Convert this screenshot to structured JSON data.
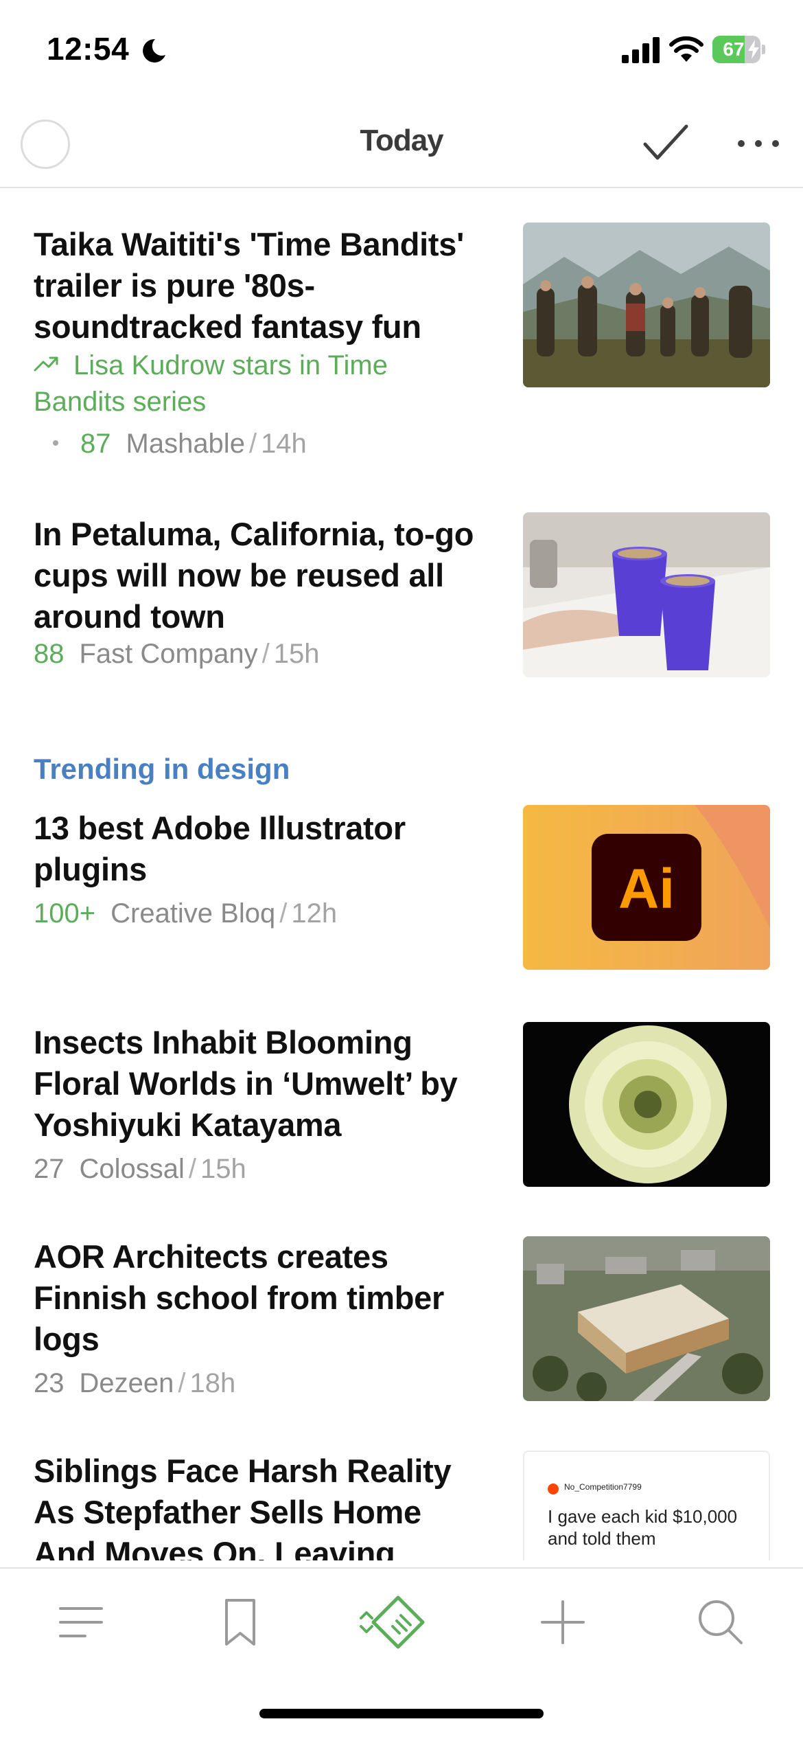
{
  "status_bar": {
    "time": "12:54",
    "battery": "67",
    "battery_level": 0.67
  },
  "nav": {
    "title": "Today"
  },
  "articles": [
    {
      "title": "Taika Waititi's 'Time Bandits' trailer is pure '80s-soundtracked fantasy fun",
      "related": "Lisa Kudrow stars in Time Bandits series",
      "count": "87",
      "source": "Mashable",
      "time": "14h"
    },
    {
      "title": "In Petaluma, California, to-go cups will now be reused all around town",
      "count": "88",
      "source": "Fast Company",
      "time": "15h"
    },
    {
      "title": "13 best Adobe Illustrator plugins",
      "count": "100+",
      "source": "Creative Bloq",
      "time": "12h"
    },
    {
      "title": "Insects Inhabit Blooming Floral Worlds in ‘Umwelt’ by Yoshiyuki Katayama",
      "count": "27",
      "source": "Colossal",
      "time": "15h"
    },
    {
      "title": "AOR Architects creates Finnish school from timber logs",
      "count": "23",
      "source": "Dezeen",
      "time": "18h"
    },
    {
      "title": "Siblings Face Harsh Reality As Stepfather Sells Home And Moves On, Leaving",
      "thumb_user": "No_Competition7799",
      "thumb_text": "I gave each kid $10,000 and told them"
    }
  ],
  "section": {
    "heading": "Trending in design"
  },
  "thumb_logo": "Ai",
  "meta_separator": "/",
  "tabs": [
    {
      "icon": "menu-icon"
    },
    {
      "icon": "bookmark-icon"
    },
    {
      "icon": "feedly-today-icon"
    },
    {
      "icon": "add-icon"
    },
    {
      "icon": "search-icon"
    }
  ],
  "colors": {
    "accent_green": "#5cad5a",
    "section_blue": "#4a7fc1",
    "meta_grey": "#8a8a8a"
  }
}
